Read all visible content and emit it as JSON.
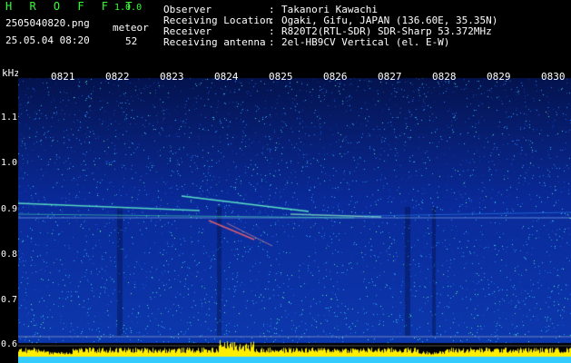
{
  "header": {
    "app_title": "H R O F F T",
    "app_version": "1.0.0",
    "file_name": "2505040820.png",
    "timestamp": "25.05.04 08:20",
    "detection_label": "meteor",
    "detection_count": "52"
  },
  "info": [
    {
      "label": "Observer",
      "value": "Takanori Kawachi"
    },
    {
      "label": "Receiving Location",
      "value": "Ogaki, Gifu, JAPAN (136.60E, 35.35N)"
    },
    {
      "label": "Receiver",
      "value": "R820T2(RTL-SDR) SDR-Sharp 53.372MHz"
    },
    {
      "label": "Receiving antenna",
      "value": "2el-HB9CV Vertical (el. E-W)"
    }
  ],
  "axis": {
    "y_unit": "kHz",
    "y_ticks": [
      "1.1",
      "1.0",
      "0.9",
      "0.8",
      "0.7",
      "0.6"
    ],
    "x_ticks": [
      "0821",
      "0822",
      "0823",
      "0824",
      "0825",
      "0826",
      "0827",
      "0828",
      "0829",
      "0830"
    ]
  },
  "colors": {
    "background": "#000000",
    "spectrum_base": "#0a2a9a",
    "spectrum_noise": "#2aa0ff",
    "echo_line": "#66ffcc",
    "meteor_head": "#ff6666",
    "baseline_bar": "#ffee00",
    "baseline_floor": "#33ccff"
  }
}
